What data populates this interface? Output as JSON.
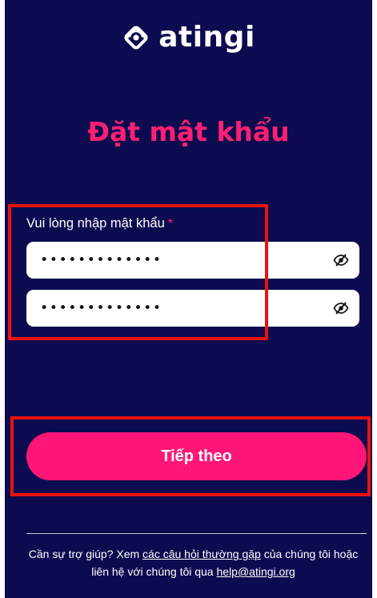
{
  "brand": {
    "name": "atingi",
    "mark_color": "#ffffff",
    "background": "#0d0b4f"
  },
  "page": {
    "title": "Đặt mật khẩu",
    "title_color": "#ff1f73"
  },
  "form": {
    "label": "Vui lòng nhập mật khẩu",
    "required_marker": "*",
    "password": {
      "value": "•••••••••••••",
      "toggle_icon": "eye-slash-icon"
    },
    "confirm_password": {
      "value": "•••••••••••••",
      "toggle_icon": "eye-slash-icon"
    }
  },
  "actions": {
    "next_label": "Tiếp theo",
    "button_color": "#ff1677"
  },
  "help": {
    "prefix": "Cần sự trợ giúp? Xem ",
    "faq_link": "các câu hỏi thường gặp",
    "middle": " của chúng tôi hoặc liên hệ với chúng tôi qua ",
    "email_link": "help@atingi.org"
  },
  "annotations": {
    "highlight_color": "#e8130f"
  }
}
